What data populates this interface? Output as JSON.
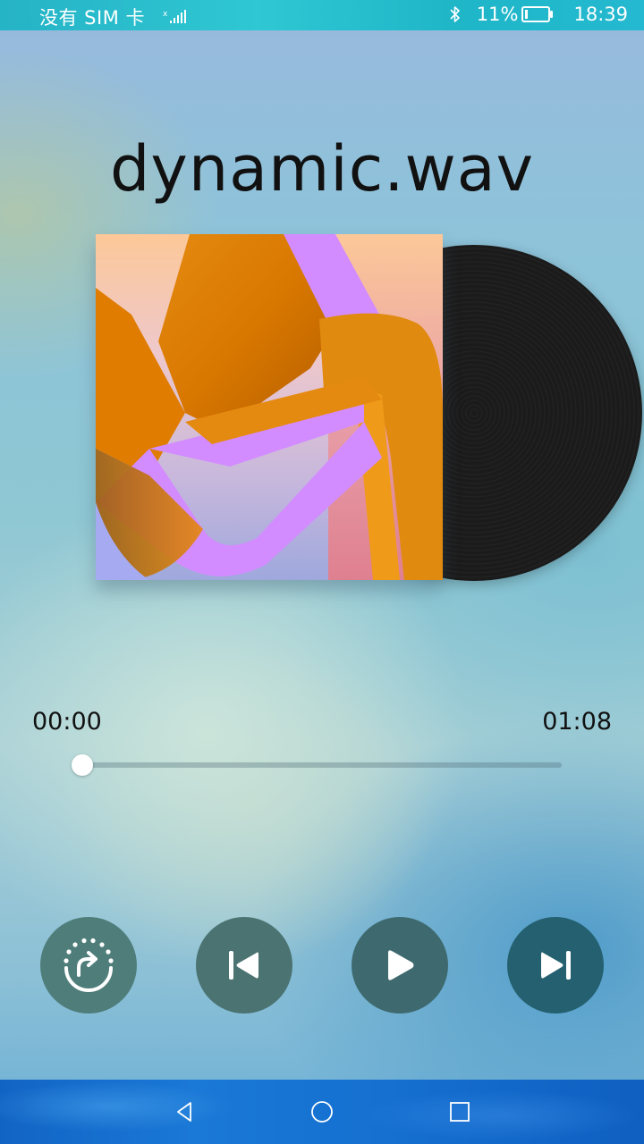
{
  "status_bar": {
    "carrier": "没有 SIM 卡",
    "battery_percent": "11%",
    "battery_level": 0.11,
    "time": "18:39",
    "icons": [
      "signal-icon",
      "bluetooth-icon",
      "battery-icon"
    ]
  },
  "player": {
    "title": "dynamic.wav",
    "current_time": "00:00",
    "total_time": "01:08",
    "progress": 0.0
  },
  "controls": {
    "repeat": "repeat-icon",
    "previous": "previous-icon",
    "play": "play-icon",
    "next": "next-icon"
  },
  "nav_bar": {
    "back": "back-icon",
    "home": "home-icon",
    "recents": "recents-icon"
  },
  "colors": {
    "status_bar": "#2fc7d3",
    "nav_bar": "#1a78d6",
    "repeat_button": "#4f7d7a",
    "prev_button": "#4b7372",
    "play_button": "#3e6a6f",
    "next_button": "#24606f"
  }
}
